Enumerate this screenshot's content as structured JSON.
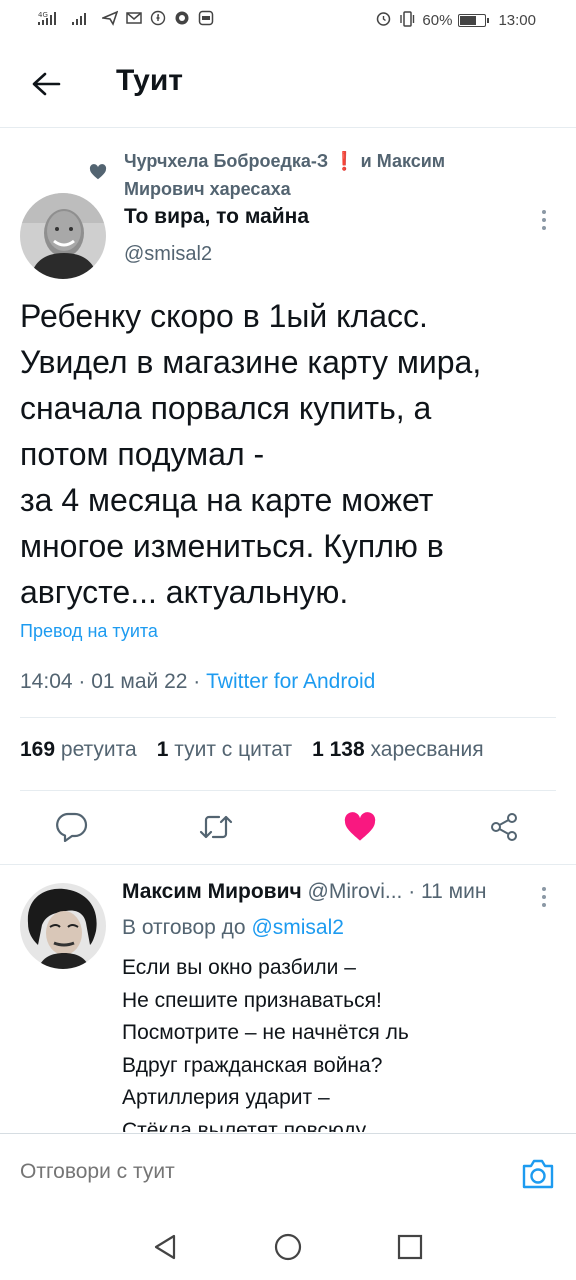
{
  "status_bar": {
    "network_left": "4G",
    "battery_percent": "60%",
    "time": "13:00"
  },
  "header": {
    "title": "Туит"
  },
  "tweet": {
    "context_part1": "Чурчхела Боброедка-З",
    "context_excl": "❗",
    "context_part2": "и Максим Мирович харесаха",
    "author_name": "То вира, то майна",
    "author_handle": "@smisal2",
    "text": "Ребенку скоро в 1ый класс.\nУвидел в магазине карту мира,\nсначала порвался купить, а\nпотом подумал -\n за 4 месяца на карте может\nмногое измениться. Куплю в\nавгусте... актуальную.",
    "translate_link": "Превод на туита",
    "timestamp": "14:04 · 01 май 22 · ",
    "source": "Twitter for Android",
    "retweets_count": "169",
    "retweets_label": "ретуита",
    "quotes_count": "1",
    "quotes_label": "туит с цитат",
    "likes_count": "1 138",
    "likes_label": "харесвания",
    "liked": true
  },
  "reply": {
    "author_name": "Максим Мирович",
    "author_handle": "@Mirovi...",
    "time": "· 11 мин",
    "reply_to_prefix": "В отговор до",
    "reply_to_mention": "@smisal2",
    "text": "Если вы окно разбили –\nНе спешите признаваться!\nПосмотрите – не начнётся ль\nВдруг гражданская война?\nАртиллерия ударит –\nСтёкла вылетят повсюду"
  },
  "composer": {
    "placeholder": "Отговори с туит"
  },
  "colors": {
    "accent": "#1d9bf0",
    "like": "#f91880",
    "secondary_text": "#536471"
  },
  "icons": [
    "back-arrow-icon",
    "heart-icon",
    "more-vertical-icon",
    "reply-icon",
    "retweet-icon",
    "like-icon",
    "share-icon",
    "camera-icon",
    "nav-back-icon",
    "nav-home-icon",
    "nav-recents-icon"
  ]
}
